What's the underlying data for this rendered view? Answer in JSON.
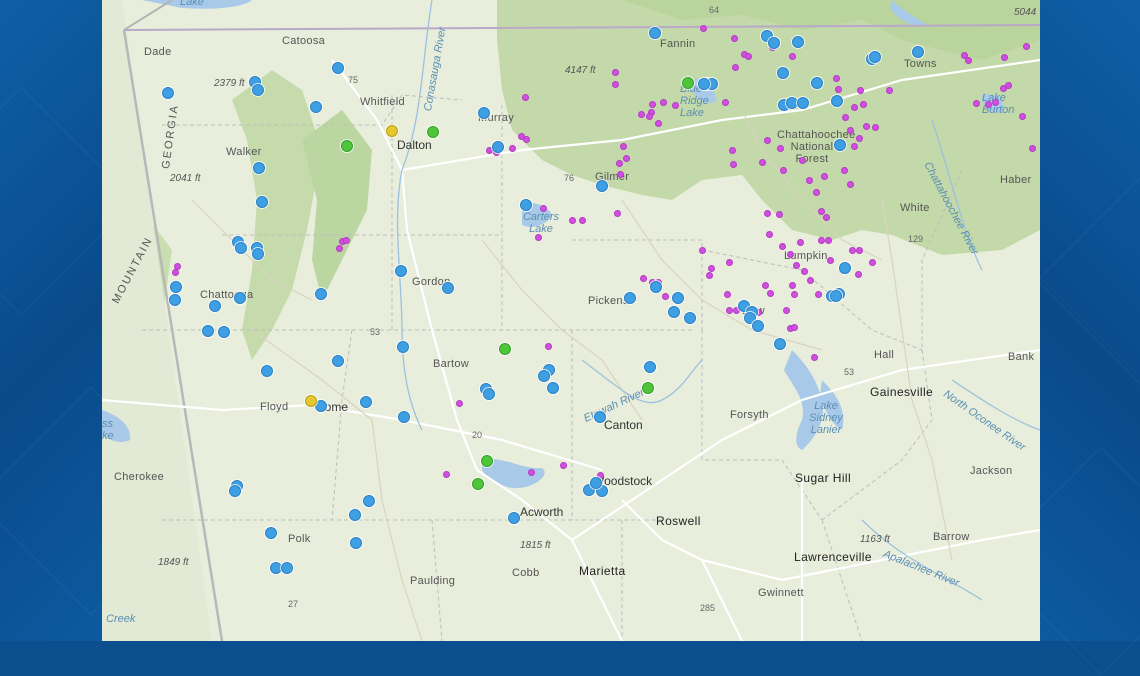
{
  "map": {
    "labels": {
      "lake_top": "Lake",
      "catoosa": "Catoosa",
      "dade": "Dade",
      "elev_2379": "2379 ft",
      "georgia": "GEORGIA",
      "walker": "Walker",
      "elev_2041": "2041 ft",
      "mountain": "MOUNTAIN",
      "whitfield": "Whitfield",
      "conasauga": "Conasauga River",
      "murray": "Murray",
      "dalton": "Dalton",
      "fannin": "Fannin",
      "elev_4147": "4147 ft",
      "blue_ridge_lake": "Blue Ridge Lake",
      "chattahoochee_nf": "Chattahoochee National Forest",
      "towns": "Towns",
      "lake_burton": "Lake Burton",
      "habersham": "Haber",
      "white": "White",
      "chattahoochee_river": "Chattahoochee River",
      "gilmer": "Gilmer",
      "carters_lake": "Carters Lake",
      "gordon": "Gordon",
      "chattooga": "Chattooga",
      "pickens": "Pickens",
      "dawson": "Daw",
      "lumpkin": "Lumpkin",
      "hall": "Hall",
      "banks": "Bank",
      "gainesville": "Gainesville",
      "north_oconee": "North Oconee River",
      "bartow": "Bartow",
      "etowah": "Etowah River",
      "floyd": "Floyd",
      "rome": "Rome",
      "forsyth": "Forsyth",
      "lake_lanier": "Lake Sidney Lanier",
      "canton": "Canton",
      "cherokee": "Cherokee",
      "woodstock": "Woodstock",
      "sugar_hill": "Sugar Hill",
      "jackson": "Jackson",
      "acworth": "Acworth",
      "roswell": "Roswell",
      "polk": "Polk",
      "elev_1815": "1815 ft",
      "elev_1163": "1163 ft",
      "barrow": "Barrow",
      "lawrenceville": "Lawrenceville",
      "elev_1849": "1849 ft",
      "paulding": "Paulding",
      "cobb": "Cobb",
      "marietta": "Marietta",
      "gwinnett": "Gwinnett",
      "apalachee": "Apalachee River",
      "weiss_lake": "ss ke",
      "creek": "Creek",
      "elev_5044": "5044",
      "hwy_64": "64",
      "hwy_75": "75",
      "hwy_76": "76",
      "hwy_53": "53",
      "hwy_53b": "53",
      "hwy_20": "20",
      "hwy_129": "129",
      "hwy_285": "285",
      "hwy_27": "27"
    },
    "marker_colors": {
      "blue": "#3ea0e3",
      "magenta": "#d14fe0",
      "green": "#4fc53a",
      "yellow": "#e5c72e"
    },
    "marker_counts": {
      "blue": 99,
      "magenta": 116,
      "green": 7,
      "yellow": 2
    }
  }
}
